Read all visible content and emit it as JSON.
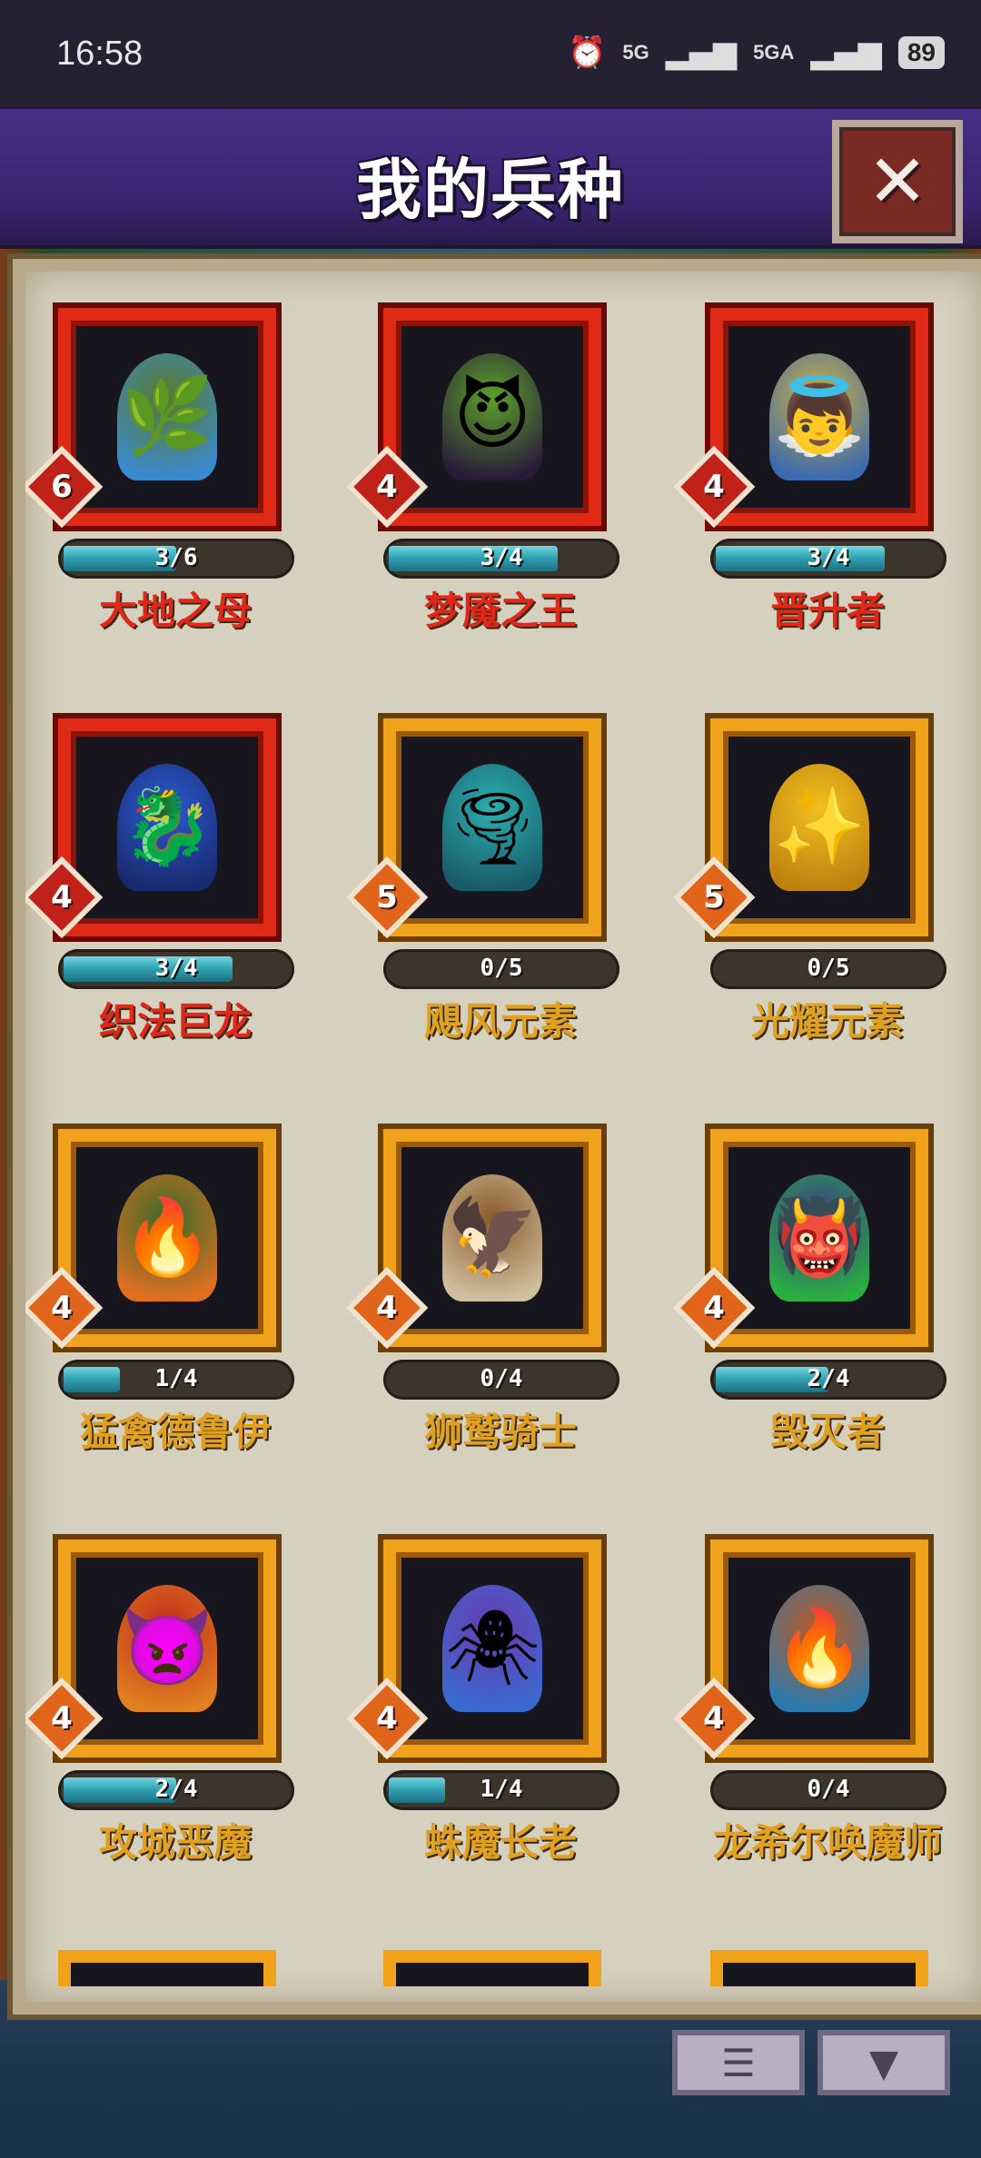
{
  "status_bar": {
    "time": "16:58",
    "signal_1": "5G",
    "signal_2": "5GA",
    "battery": "89"
  },
  "header": {
    "title": "我的兵种",
    "close_icon": "close-x-icon"
  },
  "units": [
    {
      "name": "大地之母",
      "level": "6",
      "progress": "3/6",
      "fill": 0.5,
      "tier": "red",
      "glyph": "🌿",
      "colors": [
        "#5a7a2a",
        "#3a8ad0"
      ]
    },
    {
      "name": "梦魇之王",
      "level": "4",
      "progress": "3/4",
      "fill": 0.75,
      "tier": "red",
      "glyph": "😈",
      "colors": [
        "#5aa02a",
        "#2a1a3a"
      ]
    },
    {
      "name": "晋升者",
      "level": "4",
      "progress": "3/4",
      "fill": 0.75,
      "tier": "red",
      "glyph": "👼",
      "colors": [
        "#d0b040",
        "#3a6ab0"
      ]
    },
    {
      "name": "织法巨龙",
      "level": "4",
      "progress": "3/4",
      "fill": 0.75,
      "tier": "red",
      "glyph": "🐉",
      "colors": [
        "#2a5ad0",
        "#1a2a70"
      ]
    },
    {
      "name": "飓风元素",
      "level": "5",
      "progress": "0/5",
      "fill": 0,
      "tier": "gold",
      "glyph": "🌪",
      "colors": [
        "#2ab0b0",
        "#1a5a6a"
      ]
    },
    {
      "name": "光耀元素",
      "level": "5",
      "progress": "0/5",
      "fill": 0,
      "tier": "gold",
      "glyph": "✨",
      "colors": [
        "#f0c020",
        "#c08010"
      ]
    },
    {
      "name": "猛禽德鲁伊",
      "level": "4",
      "progress": "1/4",
      "fill": 0.25,
      "tier": "gold",
      "glyph": "🔥",
      "colors": [
        "#3a6a2a",
        "#e07020"
      ]
    },
    {
      "name": "狮鹫骑士",
      "level": "4",
      "progress": "0/4",
      "fill": 0,
      "tier": "gold",
      "glyph": "🦅",
      "colors": [
        "#8a5a2a",
        "#d0c0a0"
      ]
    },
    {
      "name": "毁灭者",
      "level": "4",
      "progress": "2/4",
      "fill": 0.5,
      "tier": "gold",
      "glyph": "👹",
      "colors": [
        "#3a3a8a",
        "#2ab040"
      ]
    },
    {
      "name": "攻城恶魔",
      "level": "4",
      "progress": "2/4",
      "fill": 0.5,
      "tier": "gold",
      "glyph": "👿",
      "colors": [
        "#c02a1a",
        "#e08020"
      ]
    },
    {
      "name": "蛛魔长老",
      "level": "4",
      "progress": "1/4",
      "fill": 0.25,
      "tier": "gold",
      "glyph": "🕷",
      "colors": [
        "#6a3ab0",
        "#3a6ad0"
      ]
    },
    {
      "name": "龙希尔唤魔师",
      "level": "4",
      "progress": "0/4",
      "fill": 0,
      "tier": "gold",
      "glyph": "🔥",
      "colors": [
        "#c05a20",
        "#2a7ab0"
      ]
    }
  ],
  "toolbar": {
    "list_icon": "list-icon",
    "filter_icon": "filter-icon"
  },
  "colors": {
    "red_frame": "#e02a15",
    "gold_frame": "#f0a21a",
    "red_name": "#e0281a",
    "gold_name": "#e0a020",
    "progress_fill": "#2f9fb0"
  }
}
